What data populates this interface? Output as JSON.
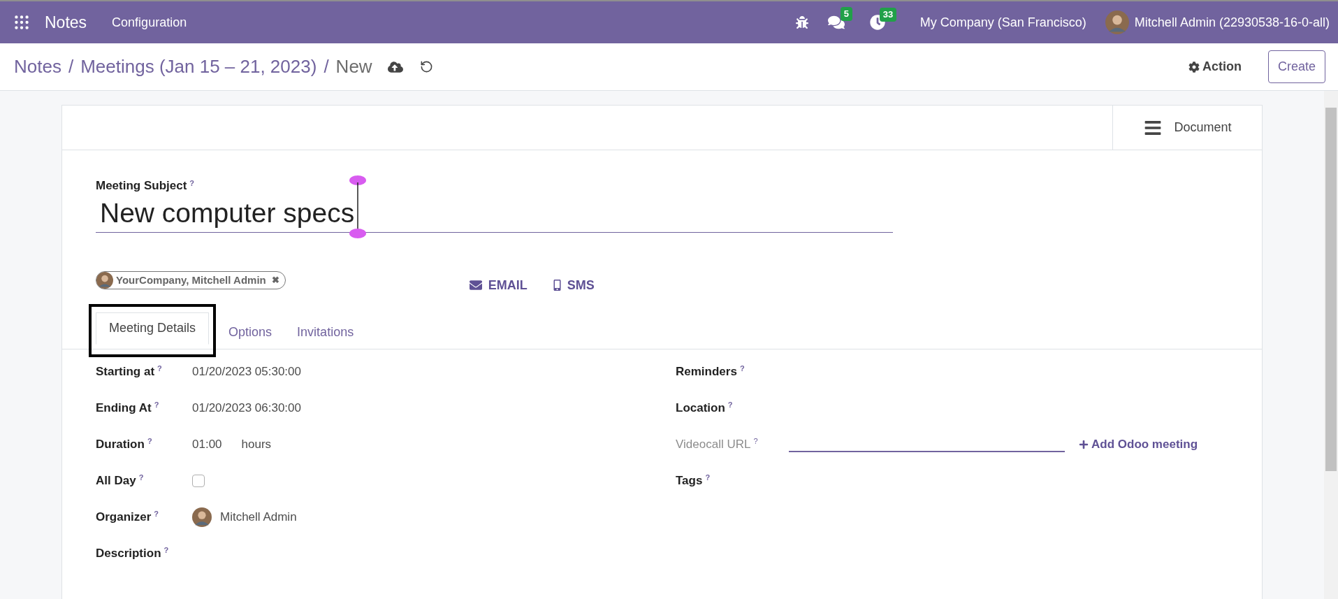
{
  "topbar": {
    "app_name": "Notes",
    "menu": [
      "Configuration"
    ],
    "chat_count": "5",
    "activity_count": "33",
    "company": "My Company (San Francisco)",
    "user": "Mitchell Admin (22930538-16-0-all)"
  },
  "breadcrumb": {
    "items": [
      "Notes",
      "Meetings (Jan 15 – 21, 2023)",
      "New"
    ],
    "separator": "/"
  },
  "control_panel": {
    "action": "Action",
    "create": "Create"
  },
  "sheet": {
    "document_button": "Document",
    "subject": {
      "label": "Meeting Subject",
      "help": "?",
      "value": "New computer specs"
    },
    "attendees": [
      {
        "name": "YourCompany, Mitchell Admin",
        "remove": "✖"
      }
    ],
    "buttons": [
      {
        "kind": "email",
        "label": "EMAIL"
      },
      {
        "kind": "sms",
        "label": "SMS"
      }
    ],
    "tabs": [
      {
        "label": "Meeting Details",
        "selected": true
      },
      {
        "label": "Options",
        "selected": false
      },
      {
        "label": "Invitations",
        "selected": false
      }
    ],
    "left_fields": [
      {
        "kind": "text",
        "label": "Starting at",
        "help": "?",
        "value": "01/20/2023 05:30:00"
      },
      {
        "kind": "text",
        "label": "Ending At",
        "help": "?",
        "value": "01/20/2023 06:30:00"
      },
      {
        "kind": "duration",
        "label": "Duration",
        "help": "?",
        "value": "01:00",
        "unit": "hours"
      },
      {
        "kind": "checkbox",
        "label": "All Day",
        "help": "?",
        "checked": false
      },
      {
        "kind": "person",
        "label": "Organizer",
        "help": "?",
        "value": "Mitchell Admin"
      },
      {
        "kind": "empty",
        "label": "Description",
        "help": "?"
      }
    ],
    "right_fields": [
      {
        "kind": "empty",
        "label": "Reminders",
        "help": "?"
      },
      {
        "kind": "empty",
        "label": "Location",
        "help": "?"
      },
      {
        "kind": "url",
        "label": "Videocall URL",
        "help": "?",
        "link": "Add Odoo meeting"
      },
      {
        "kind": "empty",
        "label": "Tags",
        "help": "?"
      }
    ]
  }
}
